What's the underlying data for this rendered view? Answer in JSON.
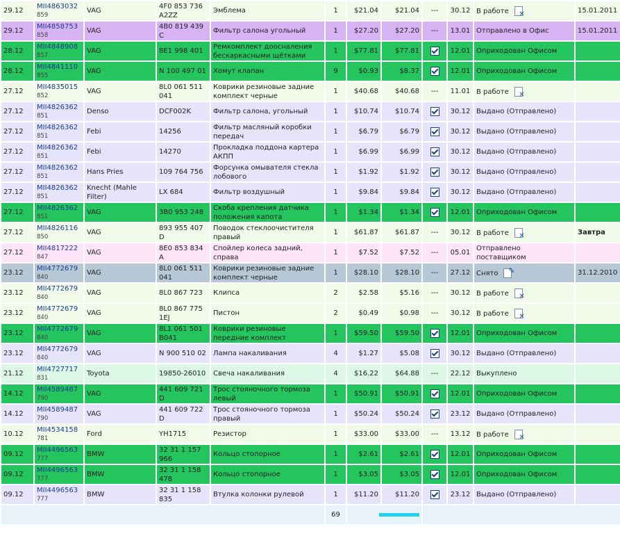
{
  "colors": {
    "light_green": "#f1fae8",
    "purple": "#d7b3f3",
    "green": "#24c55e",
    "lavender": "#e5e4fa",
    "pink": "#fde4f8",
    "grey_blue": "#b6c8d6",
    "mint": "#dcf7e6"
  },
  "rows": [
    {
      "date": "29.12",
      "order": "MII4863032",
      "sub": "859",
      "brand": "VAG",
      "code": "4F0 853 736 A2ZZ",
      "name": "Эмблема",
      "qty": "1",
      "price": "$21.04",
      "sum": "$21.04",
      "check": "---",
      "dd": "30.12",
      "status": "В работе",
      "status_icon": "cancel",
      "extra": "15.01.2011",
      "bg": "light_green"
    },
    {
      "date": "29.12",
      "order": "MII4858753",
      "sub": "858",
      "brand": "VAG",
      "code": "4B0 819 439 C",
      "name": "Фильтр салона угольный",
      "qty": "1",
      "price": "$27.20",
      "sum": "$27.20",
      "check": "---",
      "dd": "13.01",
      "status": "Отправлено в Офис",
      "status_icon": "",
      "extra": "15.01.2011",
      "bg": "purple"
    },
    {
      "date": "28.12",
      "order": "MII4848908",
      "sub": "857",
      "brand": "VAG",
      "code": "8E1 998 401",
      "name": "Ремкомплект доосналения бескаркасными щётками",
      "qty": "1",
      "price": "$77.81",
      "sum": "$77.81",
      "check": "checked",
      "dd": "12.01",
      "status": "Оприходован Офисом",
      "status_icon": "",
      "extra": "",
      "bg": "green"
    },
    {
      "date": "28.12",
      "order": "MII4841110",
      "sub": "855",
      "brand": "VAG",
      "code": "N 100 497 01",
      "name": "Хомут клапан",
      "qty": "9",
      "price": "$0.93",
      "sum": "$8.37",
      "check": "checked",
      "dd": "12.01",
      "status": "Оприходован Офисом",
      "status_icon": "",
      "extra": "",
      "bg": "green"
    },
    {
      "date": "27.12",
      "order": "MII4835015",
      "sub": "852",
      "brand": "VAG",
      "code": "8L0 061 511 041",
      "name": "Коврики резиновые задние комплект черные",
      "qty": "1",
      "price": "$40.68",
      "sum": "$40.68",
      "check": "---",
      "dd": "11.01",
      "status": "В работе",
      "status_icon": "cancel",
      "extra": "",
      "bg": "light_green"
    },
    {
      "date": "27.12",
      "order": "MII4826362",
      "sub": "851",
      "brand": "Denso",
      "code": "DCF002K",
      "name": "Фильтр салона, угольный",
      "qty": "1",
      "price": "$10.74",
      "sum": "$10.74",
      "check": "checked",
      "dd": "30.12",
      "status": "Выдано (Отправлено)",
      "status_icon": "",
      "extra": "",
      "bg": "lavender"
    },
    {
      "date": "27.12",
      "order": "MII4826362",
      "sub": "851",
      "brand": "Febi",
      "code": "14256",
      "name": "Фильтр масляный коробки передач",
      "qty": "1",
      "price": "$6.79",
      "sum": "$6.79",
      "check": "checked",
      "dd": "30.12",
      "status": "Выдано (Отправлено)",
      "status_icon": "",
      "extra": "",
      "bg": "lavender"
    },
    {
      "date": "27.12",
      "order": "MII4826362",
      "sub": "851",
      "brand": "Febi",
      "code": "14270",
      "name": "Прокладка поддона картера АКПП",
      "qty": "1",
      "price": "$6.99",
      "sum": "$6.99",
      "check": "checked",
      "dd": "30.12",
      "status": "Выдано (Отправлено)",
      "status_icon": "",
      "extra": "",
      "bg": "lavender"
    },
    {
      "date": "27.12",
      "order": "MII4826362",
      "sub": "851",
      "brand": "Hans Pries",
      "code": "109 764 756",
      "name": "Форсунка омывателя стекла лобового",
      "qty": "1",
      "price": "$1.92",
      "sum": "$1.92",
      "check": "checked",
      "dd": "30.12",
      "status": "Выдано (Отправлено)",
      "status_icon": "",
      "extra": "",
      "bg": "lavender"
    },
    {
      "date": "27.12",
      "order": "MII4826362",
      "sub": "851",
      "brand": "Knecht (Mahle Filter)",
      "code": "LX 684",
      "name": "Фильтр воздушный",
      "qty": "1",
      "price": "$9.84",
      "sum": "$9.84",
      "check": "checked",
      "dd": "30.12",
      "status": "Выдано (Отправлено)",
      "status_icon": "",
      "extra": "",
      "bg": "lavender"
    },
    {
      "date": "27.12",
      "order": "MII4826362",
      "sub": "851",
      "brand": "VAG",
      "code": "3B0 953 248",
      "name": "Скоба крепления датчика положения капота",
      "qty": "1",
      "price": "$1.34",
      "sum": "$1.34",
      "check": "checked",
      "dd": "12.01",
      "status": "Оприходован Офисом",
      "status_icon": "",
      "extra": "",
      "bg": "green"
    },
    {
      "date": "27.12",
      "order": "MII4826116",
      "sub": "850",
      "brand": "VAG",
      "code": "893 955 407 D",
      "name": "Поводок стеклоочистителя правый",
      "qty": "1",
      "price": "$61.87",
      "sum": "$61.87",
      "check": "---",
      "dd": "30.12",
      "status": "В работе",
      "status_icon": "cancel",
      "extra": "Завтра",
      "extra_bold": true,
      "bg": "light_green"
    },
    {
      "date": "27.12",
      "order": "MII4817222",
      "sub": "847",
      "brand": "VAG",
      "code": "8E0 853 834 A",
      "name": "Спойлер колеса задний, справа",
      "qty": "1",
      "price": "$7.52",
      "sum": "$7.52",
      "check": "---",
      "dd": "05.01",
      "status": "Отправлено поставщиком",
      "status_icon": "",
      "extra": "",
      "bg": "pink"
    },
    {
      "date": "23.12",
      "order": "MII4772679",
      "sub": "840",
      "brand": "VAG",
      "code": "8L0 061 511 041",
      "name": "Коврики резиновые задние комплект черные",
      "qty": "1",
      "price": "$28.10",
      "sum": "$28.10",
      "check": "---",
      "dd": "27.12",
      "status": "Снято",
      "status_icon": "edit",
      "extra": "31.12.2010",
      "bg": "grey_blue"
    },
    {
      "date": "23.12",
      "order": "MII4772679",
      "sub": "840",
      "brand": "VAG",
      "code": "8L0 867 723",
      "name": "Клипса",
      "qty": "2",
      "price": "$2.58",
      "sum": "$5.16",
      "check": "---",
      "dd": "30.12",
      "status": "В работе",
      "status_icon": "cancel",
      "extra": "",
      "bg": "light_green"
    },
    {
      "date": "23.12",
      "order": "MII4772679",
      "sub": "840",
      "brand": "VAG",
      "code": "8L0 867 775 1EJ",
      "name": "Пистон",
      "qty": "2",
      "price": "$0.49",
      "sum": "$0.98",
      "check": "---",
      "dd": "30.12",
      "status": "В работе",
      "status_icon": "cancel",
      "extra": "",
      "bg": "light_green"
    },
    {
      "date": "23.12",
      "order": "MII4772679",
      "sub": "840",
      "brand": "VAG",
      "code": "8L1 061 501 B041",
      "name": "Коврики резиновые передние комплект",
      "qty": "1",
      "price": "$59.50",
      "sum": "$59.50",
      "check": "checked",
      "dd": "12.01",
      "status": "Оприходован Офисом",
      "status_icon": "",
      "extra": "",
      "bg": "green"
    },
    {
      "date": "23.12",
      "order": "MII4772679",
      "sub": "840",
      "brand": "VAG",
      "code": "N 900 510 02",
      "name": "Лампа накаливания",
      "qty": "4",
      "price": "$1.27",
      "sum": "$5.08",
      "check": "checked",
      "dd": "30.12",
      "status": "Выдано (Отправлено)",
      "status_icon": "",
      "extra": "",
      "bg": "lavender"
    },
    {
      "date": "21.12",
      "order": "MII4727717",
      "sub": "831",
      "brand": "Toyota",
      "code": "19850-26010",
      "name": "Свеча накаливания",
      "qty": "4",
      "price": "$16.22",
      "sum": "$64.88",
      "check": "---",
      "dd": "22.12",
      "status": "Выкуплено",
      "status_icon": "",
      "extra": "",
      "bg": "mint"
    },
    {
      "date": "14.12",
      "order": "MII4589487",
      "sub": "790",
      "brand": "VAG",
      "code": "441 609 721 D",
      "name": "Трос стояночного тормоза левый",
      "qty": "1",
      "price": "$50.91",
      "sum": "$50.91",
      "check": "checked",
      "dd": "12.01",
      "status": "Оприходован Офисом",
      "status_icon": "",
      "extra": "",
      "bg": "green"
    },
    {
      "date": "14.12",
      "order": "MII4589487",
      "sub": "790",
      "brand": "VAG",
      "code": "441 609 722 D",
      "name": "Трос стояночного тормоза правый",
      "qty": "1",
      "price": "$50.24",
      "sum": "$50.24",
      "check": "checked",
      "dd": "23.12",
      "status": "Выдано (Отправлено)",
      "status_icon": "",
      "extra": "",
      "bg": "lavender"
    },
    {
      "date": "10.12",
      "order": "MII4534158",
      "sub": "781",
      "brand": "Ford",
      "code": "YH1715",
      "name": "Резистор",
      "qty": "1",
      "price": "$33.00",
      "sum": "$33.00",
      "check": "---",
      "dd": "13.12",
      "status": "В работе",
      "status_icon": "cancel",
      "extra": "",
      "bg": "light_green"
    },
    {
      "date": "09.12",
      "order": "MII4496563",
      "sub": "777",
      "brand": "BMW",
      "code": "32 31 1 157 966",
      "name": "Кольцо стопорное",
      "qty": "1",
      "price": "$2.61",
      "sum": "$2.61",
      "check": "checked",
      "dd": "12.01",
      "status": "Оприходован Офисом",
      "status_icon": "",
      "extra": "",
      "bg": "green"
    },
    {
      "date": "09.12",
      "order": "MII4496563",
      "sub": "777",
      "brand": "BMW",
      "code": "32 31 1 158 478",
      "name": "Кольцо стопорное",
      "qty": "1",
      "price": "$3.05",
      "sum": "$3.05",
      "check": "checked",
      "dd": "12.01",
      "status": "Оприходован Офисом",
      "status_icon": "",
      "extra": "",
      "bg": "green"
    },
    {
      "date": "09.12",
      "order": "MII4496563",
      "sub": "777",
      "brand": "BMW",
      "code": "32 31 1 158 835",
      "name": "Втулка колонки рулевой",
      "qty": "1",
      "price": "$11.20",
      "sum": "$11.20",
      "check": "checked",
      "dd": "23.12",
      "status": "Выдано (Отправлено)",
      "status_icon": "",
      "extra": "",
      "bg": "lavender"
    }
  ],
  "footer": {
    "qty_total": "69"
  }
}
